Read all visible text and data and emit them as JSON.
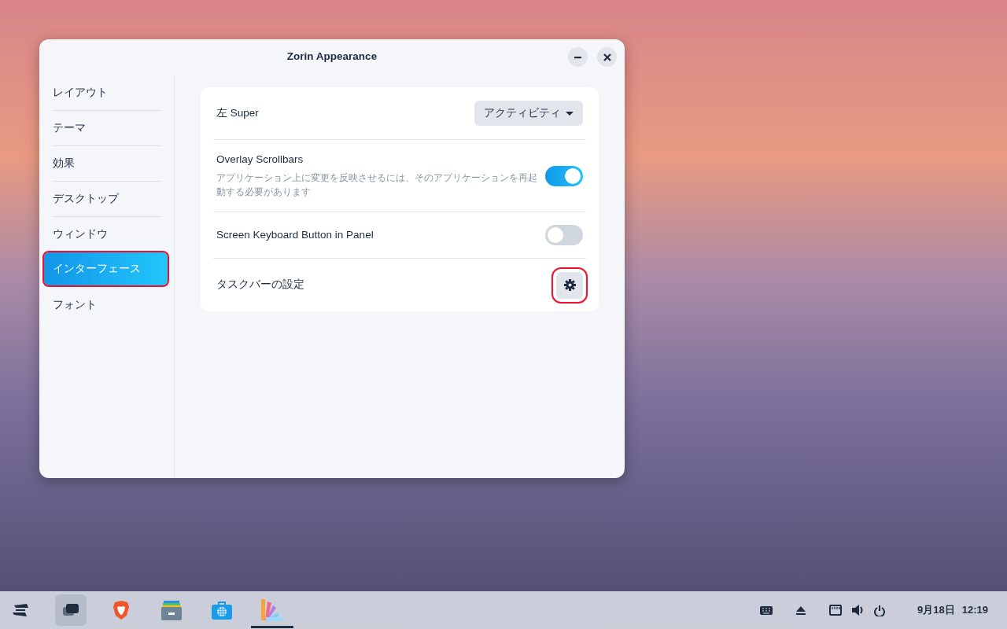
{
  "window": {
    "title": "Zorin Appearance",
    "controls": [
      {
        "kind": "minimize"
      },
      {
        "kind": "close"
      }
    ]
  },
  "sidebar": {
    "items": [
      {
        "label": "レイアウト",
        "selected": false,
        "highlighted": false
      },
      {
        "label": "テーマ",
        "selected": false,
        "highlighted": false
      },
      {
        "label": "効果",
        "selected": false,
        "highlighted": false
      },
      {
        "label": "デスクトップ",
        "selected": false,
        "highlighted": false
      },
      {
        "label": "ウィンドウ",
        "selected": false,
        "highlighted": false
      },
      {
        "label": "インターフェース",
        "selected": true,
        "highlighted": true
      },
      {
        "label": "フォント",
        "selected": false,
        "highlighted": false
      }
    ]
  },
  "settings": [
    {
      "kind": "dropdown",
      "label": "左 Super",
      "value": "アクティビティ"
    },
    {
      "kind": "switch",
      "label": "Overlay Scrollbars",
      "description": "アプリケーション上に変更を反映させるには、そのアプリケーションを再起動する必要があります",
      "on": true
    },
    {
      "kind": "switch",
      "label": "Screen Keyboard Button in Panel",
      "on": false
    },
    {
      "kind": "gear",
      "label": "タスクバーの設定",
      "highlighted": true
    }
  ],
  "taskbar": {
    "apps": [
      {
        "kind": "zorin-menu",
        "hovered": false,
        "running": false
      },
      {
        "kind": "workspaces",
        "hovered": true,
        "running": false
      },
      {
        "kind": "browser",
        "hovered": false,
        "running": false
      },
      {
        "kind": "files",
        "hovered": false,
        "running": false
      },
      {
        "kind": "store",
        "hovered": false,
        "running": false
      },
      {
        "kind": "appearance",
        "hovered": false,
        "running": true
      }
    ],
    "tray": [
      {
        "kind": "keyboard"
      },
      {
        "kind": "eject"
      },
      {
        "kind": "network"
      },
      {
        "kind": "volume"
      },
      {
        "kind": "power"
      }
    ],
    "date": "9月18日",
    "time": "12:19"
  }
}
